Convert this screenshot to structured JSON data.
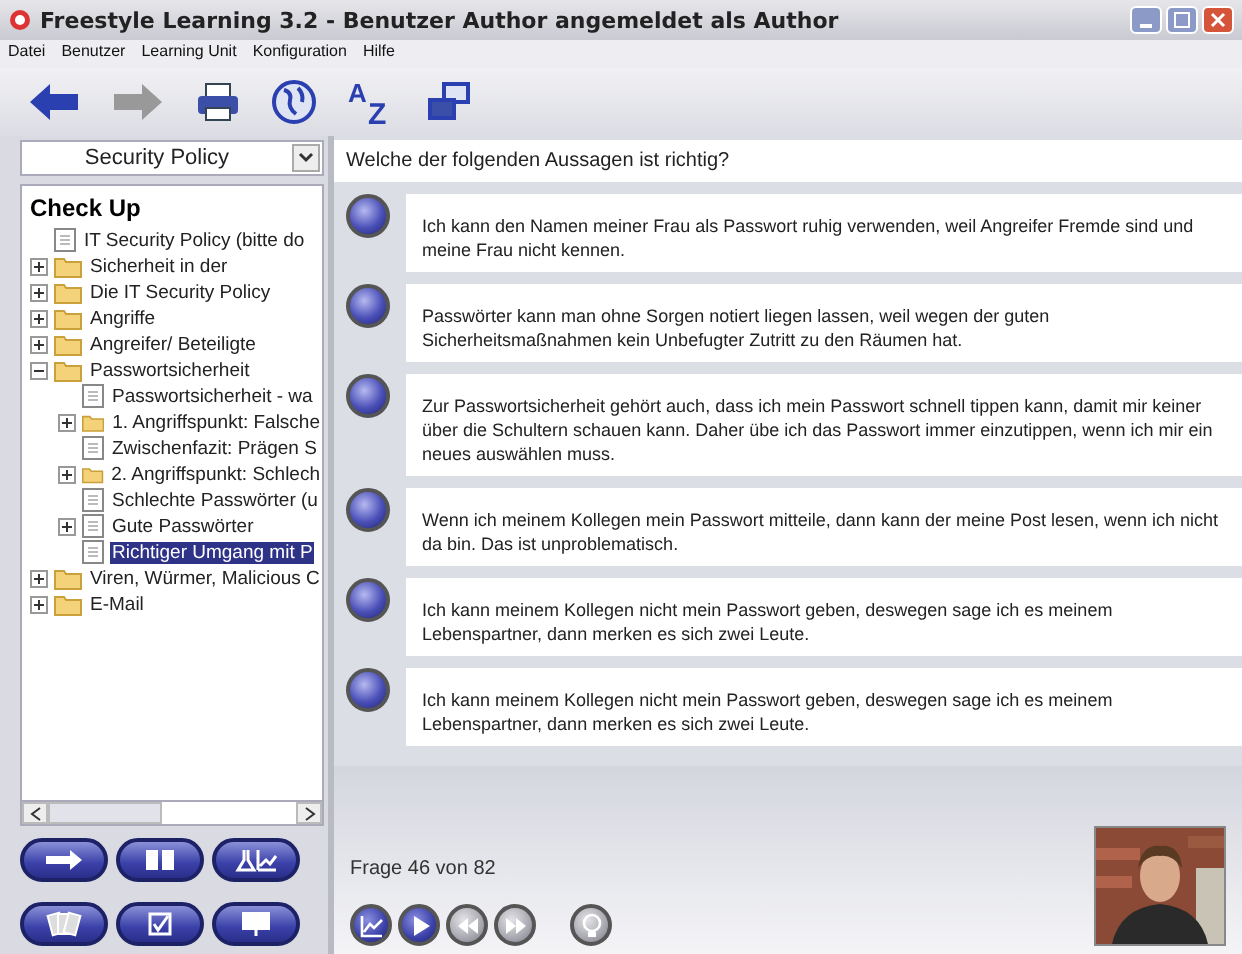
{
  "window": {
    "title": "Freestyle Learning 3.2 - Benutzer Author angemeldet als Author"
  },
  "menu": [
    "Datei",
    "Benutzer",
    "Learning Unit",
    "Konfiguration",
    "Hilfe"
  ],
  "toolbar": [
    {
      "kind": "back",
      "disabled": false
    },
    {
      "kind": "forward",
      "disabled": true
    },
    {
      "kind": "print",
      "disabled": false
    },
    {
      "kind": "globe",
      "disabled": false
    },
    {
      "kind": "sort",
      "disabled": false,
      "glyphs": [
        "A",
        "Z"
      ]
    },
    {
      "kind": "windows",
      "disabled": false
    }
  ],
  "unit_select": {
    "value": "Security Policy"
  },
  "tree": {
    "title": "Check Up",
    "items": [
      {
        "label": "IT Security Policy (bitte do",
        "kind": "page",
        "selected": false
      },
      {
        "label": "Sicherheit in der",
        "kind": "folder",
        "expanded": false,
        "selected": false
      },
      {
        "label": "Die IT Security Policy",
        "kind": "folder",
        "expanded": false,
        "selected": false
      },
      {
        "label": "Angriffe",
        "kind": "folder",
        "expanded": false,
        "selected": false
      },
      {
        "label": "Angreifer/ Beteiligte",
        "kind": "folder",
        "expanded": false,
        "selected": false
      },
      {
        "label": "Passwortsicherheit",
        "kind": "folder",
        "expanded": true,
        "selected": false,
        "children": [
          {
            "label": "Passwortsicherheit - wa",
            "kind": "page",
            "selected": false
          },
          {
            "label": "1. Angriffspunkt: Falsche",
            "kind": "folder",
            "expanded": false,
            "selected": false
          },
          {
            "label": "Zwischenfazit: Prägen S",
            "kind": "page",
            "selected": false
          },
          {
            "label": "2. Angriffspunkt: Schlech",
            "kind": "folder",
            "expanded": false,
            "selected": false
          },
          {
            "label": "Schlechte Passwörter (u",
            "kind": "page",
            "selected": false
          },
          {
            "label": "Gute Passwörter",
            "kind": "page",
            "expanded": false,
            "selected": false
          },
          {
            "label": "Richtiger Umgang mit P",
            "kind": "page",
            "selected": true
          }
        ]
      },
      {
        "label": "Viren, Würmer, Malicious C",
        "kind": "folder",
        "expanded": false,
        "selected": false
      },
      {
        "label": "E-Mail",
        "kind": "folder",
        "expanded": false,
        "selected": false
      }
    ]
  },
  "side_buttons": [
    {
      "kind": "arrow"
    },
    {
      "kind": "book"
    },
    {
      "kind": "lab"
    },
    {
      "kind": "cards"
    },
    {
      "kind": "check"
    },
    {
      "kind": "presentation"
    }
  ],
  "question": "Welche der folgenden Aussagen ist richtig?",
  "answers": [
    {
      "text": "Ich kann den Namen meiner Frau als Passwort ruhig verwenden, weil Angreifer Fremde sind und meine Frau nicht kennen.",
      "selected": false
    },
    {
      "text": "Passwörter kann man ohne Sorgen notiert liegen lassen, weil wegen der guten Sicherheitsmaßnahmen kein Unbefugter Zutritt zu den Räumen hat.",
      "selected": false
    },
    {
      "text": "Zur Passwortsicherheit gehört auch, dass ich mein Passwort schnell tippen kann, damit mir keiner über die Schultern schauen kann. Daher übe ich das Passwort immer einzutippen, wenn ich mir ein neues auswählen muss.",
      "selected": false
    },
    {
      "text": "Wenn ich meinem Kollegen mein Passwort mitteile, dann kann der meine Post lesen, wenn ich nicht da bin. Das ist unproblematisch.",
      "selected": false
    },
    {
      "text": "Ich kann meinem Kollegen nicht mein Passwort geben, deswegen sage ich es meinem Lebenspartner, dann merken es sich zwei Leute.",
      "selected": false
    },
    {
      "text": "Ich kann meinem Kollegen nicht mein Passwort geben, deswegen sage ich es meinem Lebenspartner, dann merken es sich zwei Leute.",
      "selected": false
    }
  ],
  "progress": "Frage 46 von 82",
  "nav_buttons": [
    {
      "kind": "chart",
      "disabled": false
    },
    {
      "kind": "play",
      "disabled": false
    },
    {
      "kind": "rewind",
      "disabled": true
    },
    {
      "kind": "forward",
      "disabled": true
    },
    {
      "kind": "hint",
      "disabled": true
    }
  ],
  "video": {
    "kind": "picture"
  }
}
